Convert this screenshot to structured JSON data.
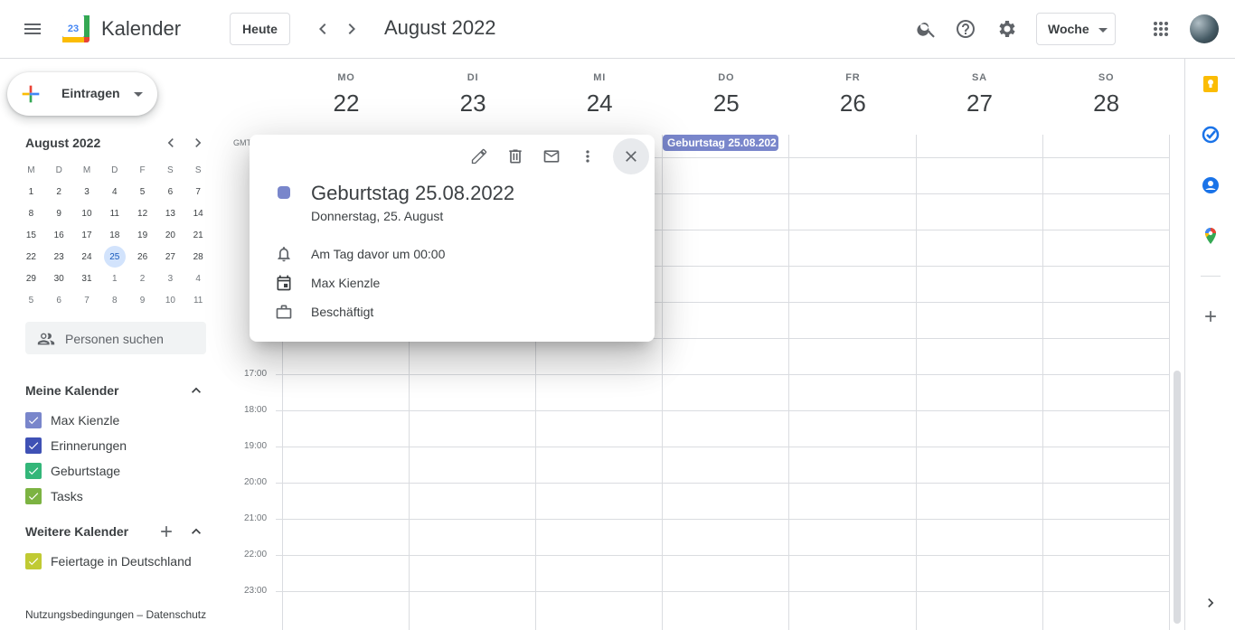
{
  "header": {
    "app_title": "Kalender",
    "logo_day": "23",
    "today_label": "Heute",
    "month_title": "August 2022",
    "view_label": "Woche"
  },
  "sidebar": {
    "create_label": "Eintragen",
    "mini_cal": {
      "title": "August 2022",
      "weekday_heads": [
        "M",
        "D",
        "M",
        "D",
        "F",
        "S",
        "S"
      ],
      "weeks": [
        [
          "1",
          "2",
          "3",
          "4",
          "5",
          "6",
          "7"
        ],
        [
          "8",
          "9",
          "10",
          "11",
          "12",
          "13",
          "14"
        ],
        [
          "15",
          "16",
          "17",
          "18",
          "19",
          "20",
          "21"
        ],
        [
          "22",
          "23",
          "24",
          "25",
          "26",
          "27",
          "28"
        ],
        [
          "29",
          "30",
          "31",
          "1",
          "2",
          "3",
          "4"
        ],
        [
          "5",
          "6",
          "7",
          "8",
          "9",
          "10",
          "11"
        ]
      ],
      "selected": "25"
    },
    "people_search_placeholder": "Personen suchen",
    "my_calendars_title": "Meine Kalender",
    "my_calendars": [
      {
        "label": "Max Kienzle",
        "color": "#7986cb"
      },
      {
        "label": "Erinnerungen",
        "color": "#3f51b5"
      },
      {
        "label": "Geburtstage",
        "color": "#33b679"
      },
      {
        "label": "Tasks",
        "color": "#7cb342"
      }
    ],
    "other_calendars_title": "Weitere Kalender",
    "other_calendars": [
      {
        "label": "Feiertage in Deutschland",
        "color": "#c0ca33"
      }
    ],
    "footer": "Nutzungsbedingungen – Datenschutz"
  },
  "week": {
    "days": [
      {
        "dow": "MO",
        "num": "22"
      },
      {
        "dow": "DI",
        "num": "23"
      },
      {
        "dow": "MI",
        "num": "24"
      },
      {
        "dow": "DO",
        "num": "25"
      },
      {
        "dow": "FR",
        "num": "26"
      },
      {
        "dow": "SA",
        "num": "27"
      },
      {
        "dow": "SO",
        "num": "28"
      }
    ],
    "timezone_label": "GMT",
    "allday_event": "Geburtstag 25.08.202",
    "hours": [
      "17:00",
      "18:00",
      "19:00",
      "20:00",
      "21:00",
      "22:00",
      "23:00"
    ]
  },
  "popup": {
    "title": "Geburtstag 25.08.2022",
    "date": "Donnerstag, 25. August",
    "reminder": "Am Tag davor um 00:00",
    "calendar": "Max Kienzle",
    "status": "Beschäftigt",
    "event_color": "#7986cb"
  }
}
